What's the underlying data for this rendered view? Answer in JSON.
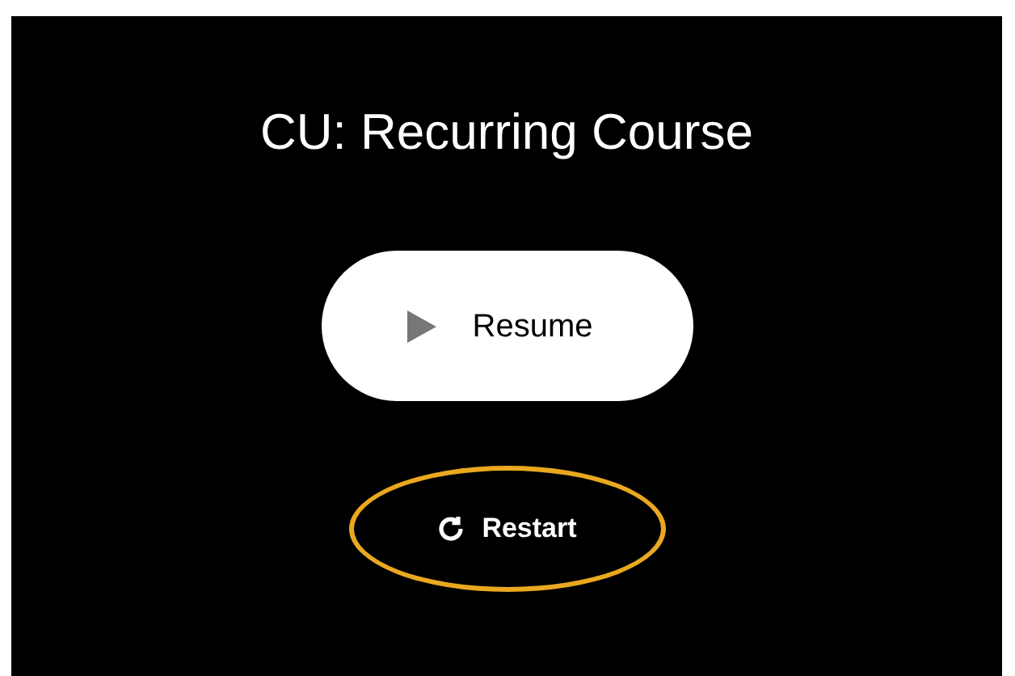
{
  "title": "CU: Recurring Course",
  "resume_button": {
    "label": "Resume"
  },
  "restart_button": {
    "label": "Restart",
    "highlighted": true
  }
}
